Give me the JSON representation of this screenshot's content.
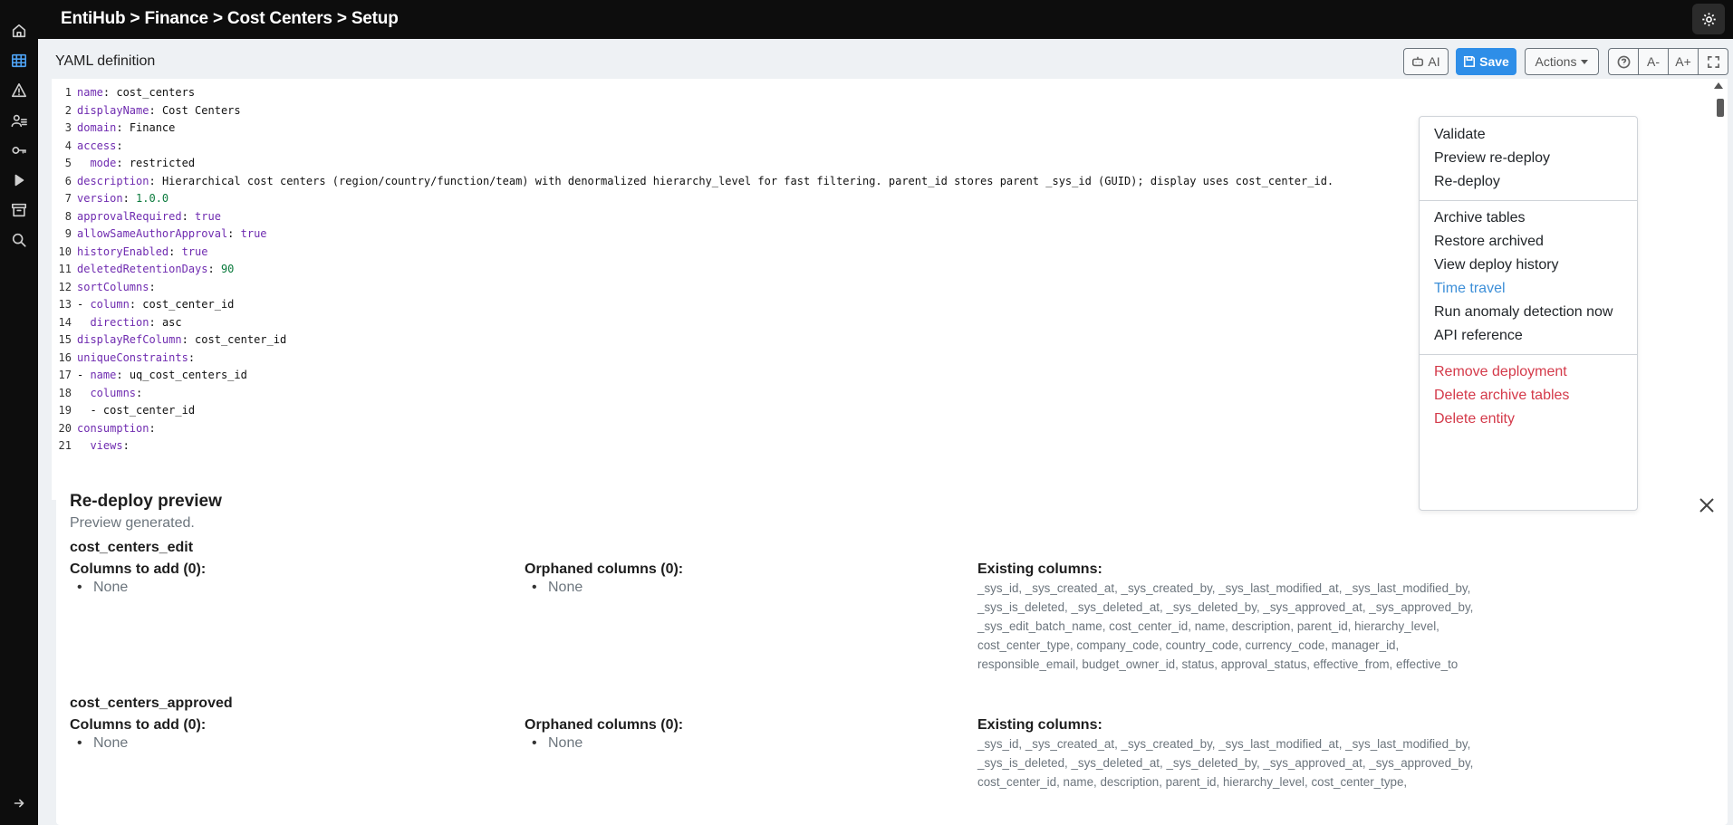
{
  "app": {
    "breadcrumb": "EntiHub > Finance > Cost Centers > Setup"
  },
  "rail": {
    "icons": [
      "home-icon",
      "table-icon",
      "warning-icon",
      "users-icon",
      "key-icon",
      "play-icon",
      "archive-icon",
      "search-icon",
      "expand-arrow-icon"
    ]
  },
  "toolbar": {
    "section_title": "YAML definition",
    "ai_label": "AI",
    "save_label": "Save",
    "actions_label": "Actions",
    "font_smaller": "A-",
    "font_larger": "A+"
  },
  "editor": {
    "lines": [
      {
        "n": "1",
        "k": "name",
        "v": "cost_centers",
        "t": "s"
      },
      {
        "n": "2",
        "k": "displayName",
        "v": "Cost Centers",
        "t": "s"
      },
      {
        "n": "3",
        "k": "domain",
        "v": "Finance",
        "t": "s"
      },
      {
        "n": "4",
        "k": "access",
        "v": "",
        "t": "s"
      },
      {
        "n": "5",
        "k": "  mode",
        "v": "restricted",
        "t": "s"
      },
      {
        "n": "6",
        "k": "description",
        "v": "Hierarchical cost centers (region/country/function/team) with denormalized hierarchy_level for fast filtering. parent_id stores parent _sys_id (GUID); display uses cost_center_id.",
        "t": "s"
      },
      {
        "n": "7",
        "k": "version",
        "v": "1.0.0",
        "t": "n"
      },
      {
        "n": "8",
        "k": "approvalRequired",
        "v": "true",
        "t": "b"
      },
      {
        "n": "9",
        "k": "allowSameAuthorApproval",
        "v": "true",
        "t": "b"
      },
      {
        "n": "10",
        "k": "historyEnabled",
        "v": "true",
        "t": "b"
      },
      {
        "n": "11",
        "k": "deletedRetentionDays",
        "v": "90",
        "t": "n"
      },
      {
        "n": "12",
        "k": "sortColumns",
        "v": "",
        "t": "s"
      },
      {
        "n": "13",
        "k": "- column",
        "v": "cost_center_id",
        "t": "s"
      },
      {
        "n": "14",
        "k": "  direction",
        "v": "asc",
        "t": "s"
      },
      {
        "n": "15",
        "k": "displayRefColumn",
        "v": "cost_center_id",
        "t": "s"
      },
      {
        "n": "16",
        "k": "uniqueConstraints",
        "v": "",
        "t": "s"
      },
      {
        "n": "17",
        "k": "- name",
        "v": "uq_cost_centers_id",
        "t": "s"
      },
      {
        "n": "18",
        "k": "  columns",
        "v": "",
        "t": "s"
      },
      {
        "n": "19",
        "k": "",
        "v": "  - cost_center_id",
        "t": "p"
      },
      {
        "n": "20",
        "k": "consumption",
        "v": "",
        "t": "s"
      },
      {
        "n": "21",
        "k": "  views",
        "v": "",
        "t": "s"
      }
    ]
  },
  "actions_menu": {
    "group1": [
      "Validate",
      "Preview re-deploy",
      "Re-deploy"
    ],
    "group2": [
      "Archive tables",
      "Restore archived",
      "View deploy history",
      "Time travel",
      "Run anomaly detection now",
      "API reference"
    ],
    "group3": [
      "Remove deployment",
      "Delete archive tables",
      "Delete entity"
    ],
    "active_item": "Time travel"
  },
  "preview": {
    "title": "Re-deploy preview",
    "subtitle": "Preview generated.",
    "sections": [
      {
        "name": "cost_centers_edit",
        "add_header": "Columns to add (0):",
        "add_value": "None",
        "orphan_header": "Orphaned columns (0):",
        "orphan_value": "None",
        "existing_header": "Existing columns:",
        "existing_lines": [
          "_sys_id, _sys_created_at, _sys_created_by, _sys_last_modified_at, _sys_last_modified_by,",
          "_sys_is_deleted, _sys_deleted_at, _sys_deleted_by, _sys_approved_at, _sys_approved_by,",
          "_sys_edit_batch_name, cost_center_id, name, description, parent_id, hierarchy_level,",
          "cost_center_type, company_code, country_code, currency_code, manager_id,",
          "responsible_email, budget_owner_id, status, approval_status, effective_from, effective_to"
        ]
      },
      {
        "name": "cost_centers_approved",
        "add_header": "Columns to add (0):",
        "add_value": "None",
        "orphan_header": "Orphaned columns (0):",
        "orphan_value": "None",
        "existing_header": "Existing columns:",
        "existing_lines": [
          "_sys_id, _sys_created_at, _sys_created_by, _sys_last_modified_at, _sys_last_modified_by,",
          "_sys_is_deleted, _sys_deleted_at, _sys_deleted_by, _sys_approved_at, _sys_approved_by,",
          "cost_center_id, name, description, parent_id, hierarchy_level, cost_center_type,"
        ]
      }
    ]
  }
}
